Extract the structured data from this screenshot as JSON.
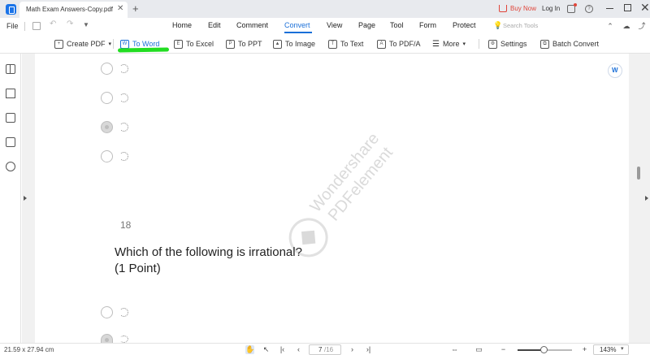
{
  "titlebar": {
    "tab_title": "Math Exam Answers-Copy.pdf",
    "buy_now": "Buy Now",
    "login": "Log In"
  },
  "menubar": {
    "file": "File",
    "items": [
      "Home",
      "Edit",
      "Comment",
      "Convert",
      "View",
      "Page",
      "Tool",
      "Form",
      "Protect"
    ],
    "active": "Convert",
    "search_placeholder": "Search Tools"
  },
  "ribbon": {
    "create_pdf": "Create PDF",
    "to_word": "To Word",
    "to_excel": "To Excel",
    "to_ppt": "To PPT",
    "to_image": "To Image",
    "to_text": "To Text",
    "to_pdfa": "To PDF/A",
    "more": "More",
    "settings": "Settings",
    "batch_convert": "Batch Convert"
  },
  "document": {
    "question_number": "18",
    "question_text": "Which of the following is irrational?",
    "question_points": "(1 Point)",
    "watermark_line1": "Wondershare",
    "watermark_line2": "PDFelement"
  },
  "statusbar": {
    "page_size": "21.59 x 27.94 cm",
    "current_page": "7",
    "total_pages": "/16",
    "zoom": "143%",
    "zoom_level": 0.5
  },
  "colors": {
    "accent": "#1a6fd8",
    "buy_now": "#e0453a",
    "highlight_mark": "#22dd22"
  }
}
